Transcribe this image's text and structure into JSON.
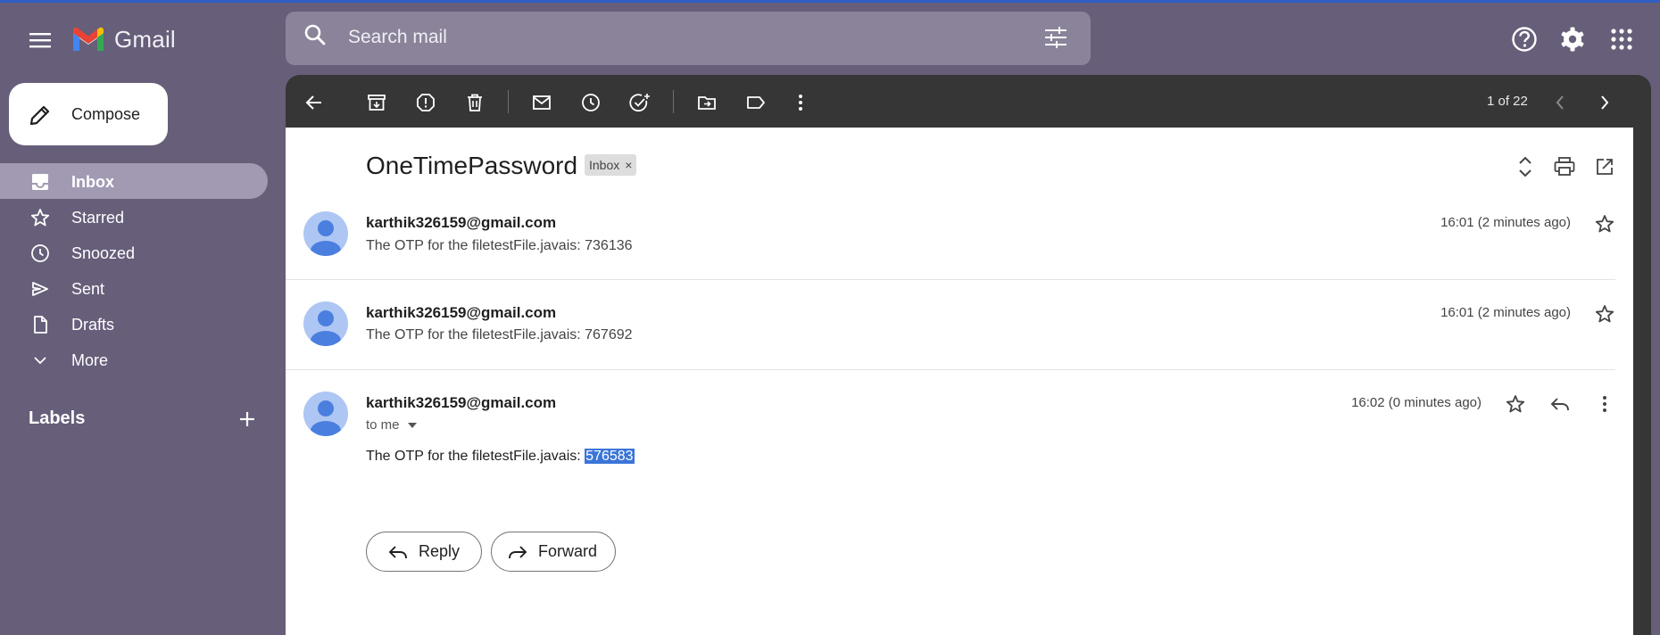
{
  "app": {
    "name": "Gmail",
    "colors": {
      "accent_blue": "#3a75d8",
      "sidebar_bg": "#675e7a",
      "active_nav": "#a29ab3"
    }
  },
  "header": {
    "search_placeholder": "Search mail",
    "icons": [
      "main-menu-icon",
      "search-icon",
      "search-options-icon",
      "help-icon",
      "settings-gear-icon",
      "apps-grid-icon"
    ]
  },
  "sidebar": {
    "compose_label": "Compose",
    "items": [
      {
        "label": "Inbox",
        "icon": "inbox-icon",
        "active": true
      },
      {
        "label": "Starred",
        "icon": "star-icon"
      },
      {
        "label": "Snoozed",
        "icon": "clock-icon"
      },
      {
        "label": "Sent",
        "icon": "send-icon"
      },
      {
        "label": "Drafts",
        "icon": "draft-file-icon"
      },
      {
        "label": "More",
        "icon": "chevron-down-icon"
      }
    ],
    "labels_heading": "Labels"
  },
  "toolbar": {
    "pager_text": "1 of 22"
  },
  "thread": {
    "subject": "OneTimePassword",
    "label_chip": "Inbox",
    "messages": [
      {
        "sender": "karthik326159@gmail.com",
        "snippet": "The OTP for the filetestFile.javais: 736136",
        "time": "16:01 (2 minutes ago)",
        "expanded": false
      },
      {
        "sender": "karthik326159@gmail.com",
        "snippet": "The OTP for the filetestFile.javais: 767692",
        "time": "16:01 (2 minutes ago)",
        "expanded": false
      },
      {
        "sender": "karthik326159@gmail.com",
        "recipient": "to me",
        "body_prefix": "The OTP for the filetestFile.javais: ",
        "body_selected": "576583",
        "time": "16:02 (0 minutes ago)",
        "expanded": true
      }
    ],
    "reply_label": "Reply",
    "forward_label": "Forward"
  }
}
